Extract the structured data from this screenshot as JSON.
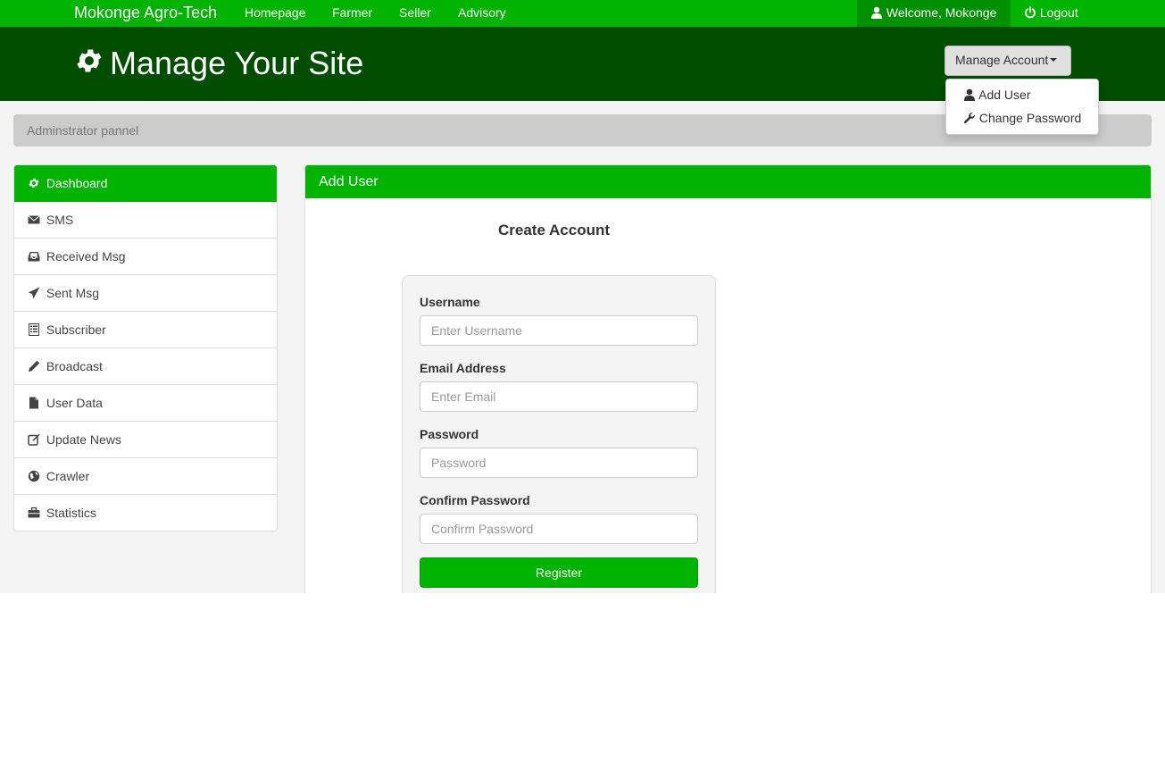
{
  "topnav": {
    "brand": "Mokonge Agro-Tech",
    "links": [
      "Homepage",
      "Farmer",
      "Seller",
      "Advisory"
    ],
    "welcome": "Welcome, Mokonge",
    "logout": "Logout"
  },
  "header": {
    "title": "Manage Your Site",
    "manage_button": "Manage Account",
    "dropdown": [
      {
        "label": "Add User",
        "icon": "user-icon"
      },
      {
        "label": "Change Password",
        "icon": "wrench-icon"
      }
    ]
  },
  "breadcrumb": "Adminstrator pannel",
  "sidebar": {
    "items": [
      {
        "label": "Dashboard",
        "icon": "gear-icon"
      },
      {
        "label": "SMS",
        "icon": "envelope-icon"
      },
      {
        "label": "Received Msg",
        "icon": "inbox-icon"
      },
      {
        "label": "Sent Msg",
        "icon": "send-icon"
      },
      {
        "label": "Subscriber",
        "icon": "list-icon"
      },
      {
        "label": "Broadcast",
        "icon": "pencil-icon"
      },
      {
        "label": "User Data",
        "icon": "file-icon"
      },
      {
        "label": "Update News",
        "icon": "edit-icon"
      },
      {
        "label": "Crawler",
        "icon": "globe-icon"
      },
      {
        "label": "Statistics",
        "icon": "briefcase-icon"
      }
    ]
  },
  "panel": {
    "heading": "Add User",
    "form_title": "Create Account",
    "fields": [
      {
        "label": "Username",
        "placeholder": "Enter Username"
      },
      {
        "label": "Email Address",
        "placeholder": "Enter Email"
      },
      {
        "label": "Password",
        "placeholder": "Password"
      },
      {
        "label": "Confirm Password",
        "placeholder": "Confirm Password"
      }
    ],
    "submit": "Register"
  },
  "colors": {
    "primary_green": "#00b300",
    "dark_green": "#004d00",
    "welcome_bg": "#009000",
    "page_bg": "#f4f4f4"
  }
}
